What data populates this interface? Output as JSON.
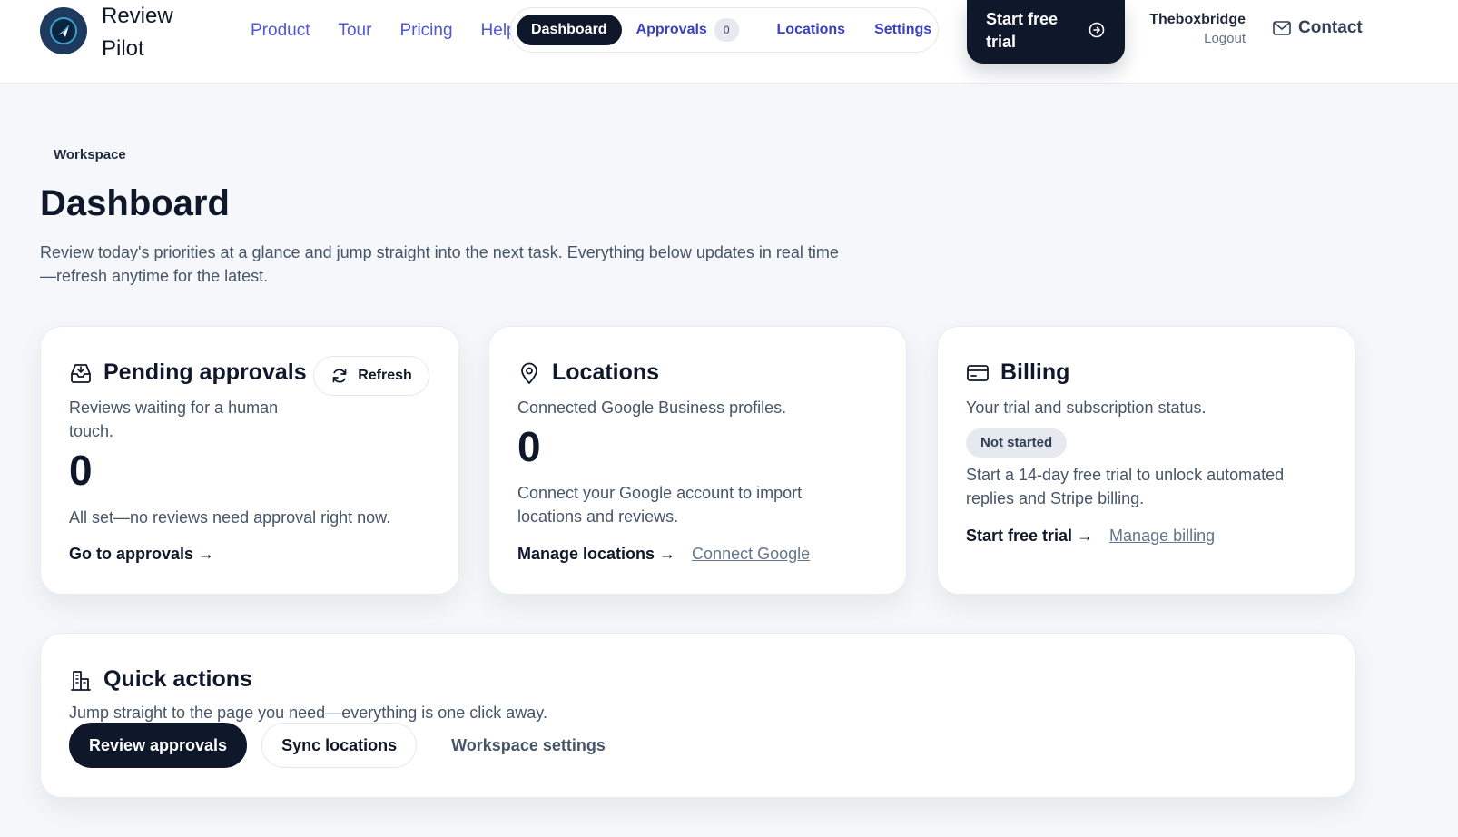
{
  "brand": {
    "name": "Review Pilot"
  },
  "top_nav": [
    "Product",
    "Tour",
    "Pricing",
    "Help"
  ],
  "app_nav": {
    "dashboard": "Dashboard",
    "approvals": "Approvals",
    "approvals_count": "0",
    "locations": "Locations",
    "settings": "Settings"
  },
  "cta": {
    "label": "Start free trial"
  },
  "user": {
    "name": "Theboxbridge",
    "logout": "Logout"
  },
  "contact": {
    "label": "Contact"
  },
  "intro": {
    "eyebrow": "Workspace",
    "title": "Dashboard",
    "description": "Review today's priorities at a glance and jump straight into the next task. Everything below updates in real time—refresh anytime for the latest."
  },
  "cards": {
    "pending": {
      "title": "Pending approvals",
      "refresh": "Refresh",
      "subtitle": "Reviews waiting for a human touch.",
      "count": "0",
      "message": "All set—no reviews need approval right now.",
      "link": "Go to approvals →"
    },
    "locations": {
      "title": "Locations",
      "subtitle": "Connected Google Business profiles.",
      "count": "0",
      "message": "Connect your Google account to import locations and reviews.",
      "link": "Manage locations →",
      "secondary_link": "Connect Google"
    },
    "billing": {
      "title": "Billing",
      "subtitle": "Your trial and subscription status.",
      "status": "Not started",
      "message": "Start a 14-day free trial to unlock automated replies and Stripe billing.",
      "link": "Start free trial →",
      "secondary_link": "Manage billing"
    }
  },
  "quick_actions": {
    "title": "Quick actions",
    "subtitle": "Jump straight to the page you need—everything is one click away.",
    "buttons": {
      "review": "Review approvals",
      "sync": "Sync locations",
      "settings": "Workspace settings"
    }
  },
  "icons": {
    "logo": "paper-plane-logo",
    "refresh": "refresh-icon",
    "inbox": "inbox-icon",
    "pin": "map-pin-icon",
    "card": "credit-card-icon",
    "building": "building-icon",
    "mail": "mail-icon",
    "arrow": "arrow-right-circle-icon"
  },
  "colors": {
    "primary": "#0f172a",
    "link": "#4f57d6",
    "background": "#f5f7fa"
  }
}
